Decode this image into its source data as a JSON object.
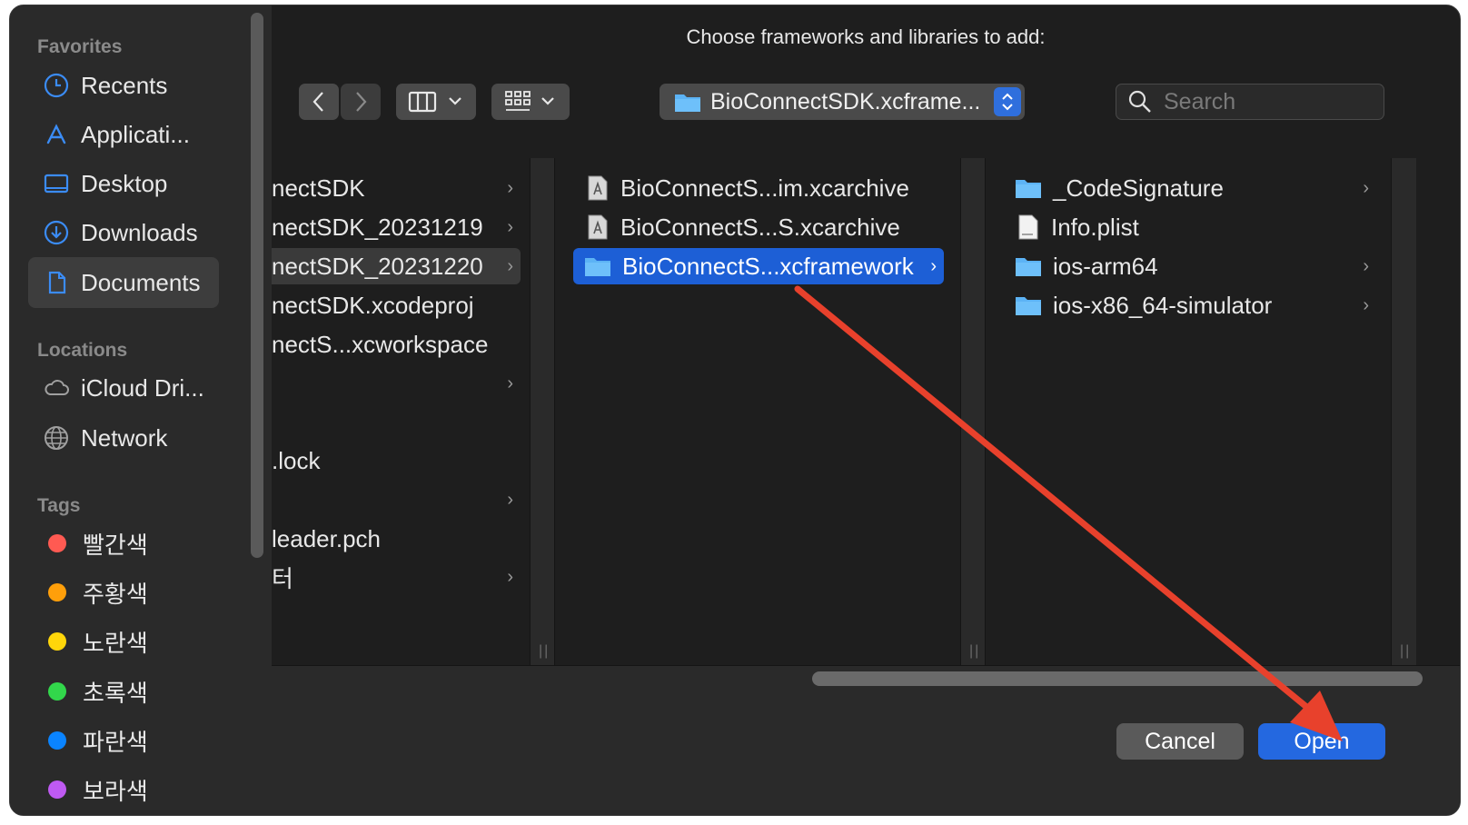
{
  "dialog": {
    "title": "Choose frameworks and libraries to add:"
  },
  "sidebar": {
    "favorites_header": "Favorites",
    "favorites": [
      {
        "label": "Recents",
        "icon": "clock-icon"
      },
      {
        "label": "Applicati...",
        "icon": "applications-icon"
      },
      {
        "label": "Desktop",
        "icon": "desktop-icon"
      },
      {
        "label": "Downloads",
        "icon": "downloads-icon"
      },
      {
        "label": "Documents",
        "icon": "document-icon",
        "selected": true
      }
    ],
    "locations_header": "Locations",
    "locations": [
      {
        "label": "iCloud Dri...",
        "icon": "cloud-icon"
      },
      {
        "label": "Network",
        "icon": "globe-icon"
      }
    ],
    "tags_header": "Tags",
    "tags": [
      {
        "label": "빨간색",
        "color": "#ff5a52"
      },
      {
        "label": "주황색",
        "color": "#ff9f0a"
      },
      {
        "label": "노란색",
        "color": "#ffd60a"
      },
      {
        "label": "초록색",
        "color": "#32d74b"
      },
      {
        "label": "파란색",
        "color": "#0a84ff"
      },
      {
        "label": "보라색",
        "color": "#bf5af2"
      }
    ]
  },
  "toolbar": {
    "path_label": "BioConnectSDK.xcframe...",
    "search_placeholder": "Search"
  },
  "columns": {
    "col1": [
      {
        "label": "nectSDK",
        "chevron": true
      },
      {
        "label": "nectSDK_20231219",
        "chevron": true
      },
      {
        "label": "nectSDK_20231220",
        "chevron": true,
        "highlight": true
      },
      {
        "label": "nectSDK.xcodeproj",
        "chevron": false
      },
      {
        "label": "nectS...xcworkspace",
        "chevron": false
      },
      {
        "label": "",
        "chevron": true
      },
      {
        "label": ".lock",
        "chevron": false
      },
      {
        "label": "",
        "chevron": true
      },
      {
        "label": "leader.pch",
        "chevron": false
      },
      {
        "label": "터",
        "chevron": true
      }
    ],
    "col2": [
      {
        "label": "BioConnectS...im.xcarchive",
        "icon": "archive-icon"
      },
      {
        "label": "BioConnectS...S.xcarchive",
        "icon": "archive-icon"
      },
      {
        "label": "BioConnectS...xcframework",
        "icon": "folder-icon",
        "selected": true,
        "chevron": true
      }
    ],
    "col3": [
      {
        "label": "_CodeSignature",
        "icon": "folder-icon",
        "chevron": true
      },
      {
        "label": "Info.plist",
        "icon": "plist-icon",
        "chevron": false
      },
      {
        "label": "ios-arm64",
        "icon": "folder-icon",
        "chevron": true
      },
      {
        "label": "ios-x86_64-simulator",
        "icon": "folder-icon",
        "chevron": true
      }
    ]
  },
  "footer": {
    "cancel_label": "Cancel",
    "open_label": "Open"
  },
  "colors": {
    "accent": "#2468e0",
    "selection": "#1d5fd6",
    "annotation_arrow": "#e8412c"
  }
}
